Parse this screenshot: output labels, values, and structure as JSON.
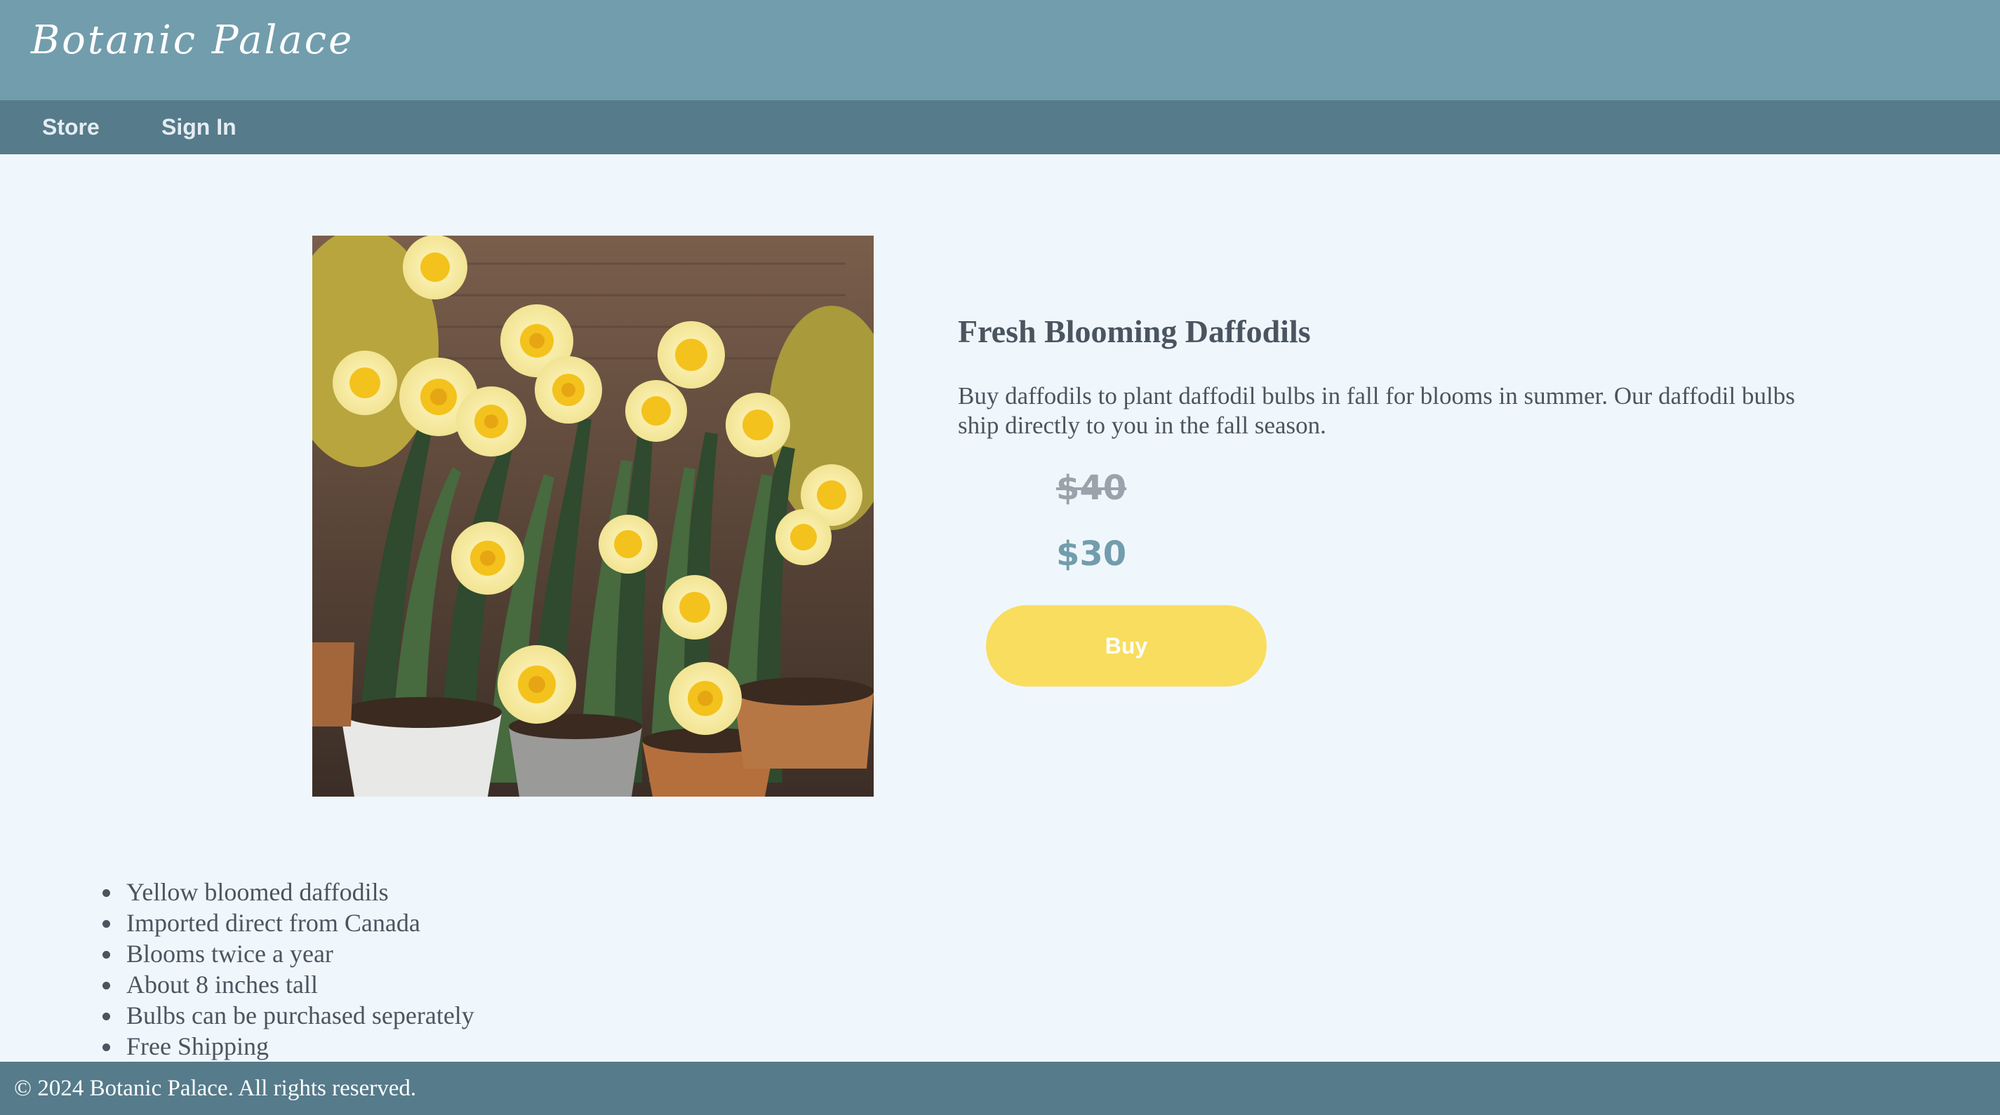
{
  "header": {
    "brand": "Botanic Palace"
  },
  "nav": {
    "store": "Store",
    "sign_in": "Sign In"
  },
  "product": {
    "title": "Fresh Blooming Daffodils",
    "description": "Buy daffodils to plant daffodil bulbs in fall for blooms in summer. Our daffodil bulbs ship directly to you in the fall season.",
    "price_original": "$40",
    "price_sale": "$30",
    "buy_label": "Buy",
    "image_subject": "potted yellow daffodils photo"
  },
  "features": [
    "Yellow bloomed daffodils",
    "Imported direct from Canada",
    "Blooms twice a year",
    "About 8 inches tall",
    "Bulbs can be purchased seperately",
    "Free Shipping"
  ],
  "footer": {
    "copyright": "© 2024 Botanic Palace. All rights reserved."
  },
  "colors": {
    "header_bg": "#729dac",
    "nav_bg": "#567b8b",
    "page_bg": "#f0f7fc",
    "accent_price": "#729dac",
    "buy_button": "#f9dd5e",
    "text": "#4a5560"
  }
}
